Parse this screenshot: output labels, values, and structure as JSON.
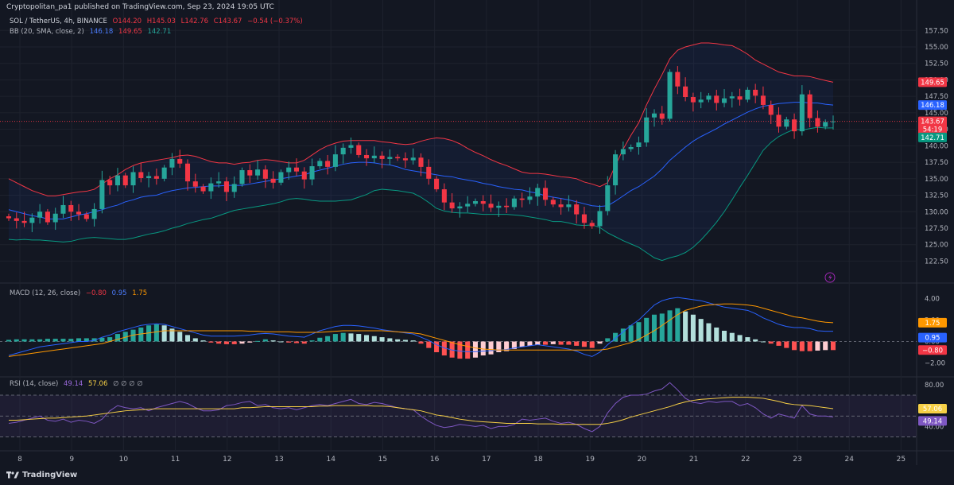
{
  "header": {
    "published": "Cryptopolitan_pa1 published on TradingView.com, Sep 23, 2024 19:05 UTC"
  },
  "symbol": {
    "name": "SOL / TetherUS, 4h, BINANCE",
    "o": "O144.20",
    "h": "H145.03",
    "l": "L142.76",
    "c": "C143.67",
    "chg": "−0.54 (−0.37%)"
  },
  "bb": {
    "label": "BB (20, SMA, close, 2)",
    "basis": "146.18",
    "upper": "149.65",
    "lower": "142.71"
  },
  "macd_legend": {
    "label": "MACD (12, 26, close)",
    "hist": "−0.80",
    "macd": "0.95",
    "signal": "1.75"
  },
  "rsi_legend": {
    "label": "RSI (14, close)",
    "rsi": "49.14",
    "ma": "57.06",
    "extra": "∅ ∅ ∅ ∅"
  },
  "footer": {
    "brand": "TradingView"
  },
  "colors": {
    "bg": "#131722",
    "up": "#26a69a",
    "down": "#f23645",
    "bb_basis": "#2962ff",
    "bb_upper": "#f23645",
    "bb_lower": "#089981",
    "macd": "#2962ff",
    "signal": "#ff9800",
    "rsi": "#7e57c2",
    "rsi_ma": "#f7d046"
  },
  "chart_data": [
    {
      "type": "candlestick",
      "title": "SOL / TetherUS, 4h, BINANCE",
      "x_ticks": [
        "8",
        "9",
        "10",
        "11",
        "12",
        "13",
        "14",
        "15",
        "16",
        "17",
        "18",
        "19",
        "20",
        "21",
        "22",
        "23",
        "24",
        "25"
      ],
      "y_ticks": [
        "122.50",
        "125.00",
        "127.50",
        "130.00",
        "132.50",
        "135.00",
        "137.50",
        "140.00",
        "142.50",
        "145.00",
        "147.50",
        "150.00",
        "152.50",
        "155.00",
        "157.50"
      ],
      "ylim": [
        120.5,
        158.5
      ],
      "price_labels": {
        "upper": "149.65",
        "basis": "146.18",
        "last": "143.67",
        "countdown": "54:19",
        "lower": "142.71"
      },
      "close": [
        129.0,
        128.6,
        128.3,
        129.1,
        130.0,
        128.4,
        129.7,
        131.0,
        130.0,
        129.6,
        128.9,
        130.4,
        134.8,
        134.0,
        135.5,
        134.0,
        136.0,
        135.1,
        135.4,
        135.0,
        136.7,
        138.0,
        137.3,
        134.6,
        133.8,
        133.1,
        134.3,
        134.6,
        133.0,
        134.2,
        136.3,
        135.5,
        136.4,
        135.0,
        134.4,
        136.0,
        136.7,
        136.1,
        134.9,
        136.9,
        137.7,
        136.8,
        138.7,
        139.7,
        140.1,
        138.6,
        138.1,
        138.5,
        138.0,
        138.3,
        138.1,
        137.8,
        138.2,
        136.8,
        135.0,
        133.4,
        131.4,
        130.5,
        130.8,
        131.2,
        131.6,
        131.2,
        130.6,
        130.9,
        130.7,
        132.0,
        131.8,
        132.3,
        133.6,
        131.8,
        131.1,
        130.7,
        131.1,
        129.6,
        128.3,
        127.8,
        130.1,
        134.0,
        138.7,
        139.5,
        139.8,
        140.5,
        144.3,
        144.9,
        144.1,
        151.2,
        149.0,
        147.4,
        146.6,
        147.0,
        147.6,
        146.5,
        147.2,
        147.5,
        147.0,
        148.5,
        147.6,
        146.2,
        144.7,
        142.9,
        144.0,
        142.2,
        147.8,
        144.2,
        142.9,
        143.6,
        143.7
      ],
      "bb_upper": [
        135.0,
        134.4,
        133.8,
        133.2,
        132.8,
        132.4,
        132.4,
        132.6,
        132.8,
        133.0,
        133.1,
        133.4,
        134.2,
        135.0,
        135.6,
        136.4,
        137.0,
        137.4,
        137.6,
        137.8,
        138.0,
        138.2,
        138.5,
        138.6,
        138.4,
        138.0,
        137.6,
        137.4,
        137.4,
        137.2,
        137.4,
        137.5,
        137.8,
        137.9,
        137.8,
        137.6,
        137.4,
        137.4,
        137.8,
        138.6,
        139.4,
        140.0,
        140.4,
        140.7,
        140.8,
        140.8,
        140.8,
        140.8,
        140.6,
        140.5,
        140.3,
        140.2,
        140.3,
        140.7,
        141.0,
        141.2,
        141.1,
        140.8,
        140.3,
        139.6,
        139.0,
        138.5,
        137.9,
        137.4,
        137.0,
        136.5,
        136.0,
        135.8,
        135.8,
        135.7,
        135.5,
        135.3,
        135.2,
        135.0,
        134.5,
        134.2,
        133.8,
        134.4,
        137.0,
        139.5,
        141.6,
        143.5,
        146.2,
        148.6,
        150.8,
        153.2,
        154.5,
        155.0,
        155.3,
        155.6,
        155.6,
        155.5,
        155.3,
        155.2,
        154.6,
        153.9,
        153.0,
        152.4,
        151.8,
        151.2,
        150.9,
        150.6,
        150.6,
        150.5,
        150.2,
        149.9,
        149.65
      ],
      "bb_basis": [
        130.3,
        130.0,
        129.7,
        129.4,
        129.2,
        128.9,
        128.9,
        128.9,
        129.2,
        129.5,
        129.7,
        130.0,
        130.3,
        130.7,
        131.0,
        131.5,
        131.8,
        132.2,
        132.4,
        132.5,
        132.9,
        133.2,
        133.4,
        133.6,
        133.7,
        133.8,
        133.9,
        133.9,
        134.0,
        134.0,
        134.0,
        134.2,
        134.4,
        134.6,
        134.8,
        135.0,
        135.2,
        135.4,
        135.6,
        136.0,
        136.3,
        136.6,
        136.9,
        137.2,
        137.4,
        137.5,
        137.5,
        137.4,
        137.2,
        137.1,
        136.8,
        136.4,
        136.2,
        136.0,
        135.8,
        135.6,
        135.4,
        135.3,
        135.0,
        134.8,
        134.6,
        134.3,
        134.1,
        133.8,
        133.6,
        133.4,
        133.3,
        133.0,
        132.8,
        132.4,
        132.2,
        132.0,
        131.8,
        131.5,
        131.2,
        130.9,
        130.8,
        130.9,
        131.6,
        132.4,
        133.2,
        133.8,
        134.6,
        135.4,
        136.5,
        137.8,
        138.8,
        139.8,
        140.7,
        141.4,
        142.0,
        142.6,
        143.3,
        143.9,
        144.5,
        145.1,
        145.6,
        146.0,
        146.2,
        146.4,
        146.5,
        146.6,
        146.6,
        146.5,
        146.5,
        146.3,
        146.18
      ],
      "bb_lower": [
        125.8,
        125.7,
        125.8,
        125.7,
        125.7,
        125.6,
        125.5,
        125.4,
        125.5,
        125.8,
        126.0,
        126.1,
        126.0,
        125.9,
        125.8,
        125.8,
        126.0,
        126.3,
        126.6,
        126.8,
        127.1,
        127.5,
        127.8,
        128.2,
        128.5,
        128.8,
        129.0,
        129.4,
        129.8,
        130.2,
        130.4,
        130.6,
        130.8,
        131.0,
        131.2,
        131.5,
        131.9,
        132.0,
        131.9,
        131.7,
        131.6,
        131.6,
        131.6,
        131.7,
        131.8,
        132.2,
        132.6,
        133.2,
        133.4,
        133.3,
        133.2,
        133.0,
        132.8,
        132.2,
        131.4,
        130.5,
        130.1,
        129.9,
        129.8,
        129.8,
        129.7,
        129.6,
        129.6,
        129.6,
        129.6,
        129.5,
        129.4,
        129.2,
        129.0,
        128.8,
        128.5,
        128.5,
        128.3,
        128.0,
        127.9,
        128.0,
        127.6,
        126.8,
        126.2,
        125.6,
        125.1,
        124.6,
        123.8,
        123.0,
        122.6,
        123.0,
        123.3,
        123.8,
        124.6,
        125.7,
        127.0,
        128.4,
        130.0,
        131.8,
        133.7,
        135.5,
        137.4,
        139.3,
        140.5,
        141.4,
        142.0,
        142.5,
        142.4,
        142.6,
        142.8,
        142.7,
        142.71
      ]
    },
    {
      "type": "bar",
      "title": "MACD (12, 26, close)",
      "y_ticks": [
        "4.00",
        "2.00",
        "0.00",
        "−2.00"
      ],
      "ylim": [
        -3.0,
        5.0
      ],
      "price_labels": {
        "signal": "1.75",
        "macd": "0.95",
        "hist": "−0.80"
      },
      "hist": [
        0.15,
        0.2,
        0.2,
        0.2,
        0.2,
        0.25,
        0.25,
        0.25,
        0.25,
        0.3,
        0.3,
        0.3,
        0.35,
        0.4,
        0.7,
        0.9,
        1.1,
        1.3,
        1.5,
        1.6,
        1.5,
        1.2,
        0.9,
        0.6,
        0.3,
        0.1,
        -0.1,
        -0.2,
        -0.25,
        -0.25,
        -0.2,
        -0.1,
        0.05,
        0.2,
        0.1,
        0.0,
        -0.1,
        -0.15,
        -0.2,
        0.1,
        0.35,
        0.5,
        0.7,
        0.8,
        0.75,
        0.7,
        0.6,
        0.5,
        0.4,
        0.3,
        0.2,
        0.15,
        0.1,
        -0.2,
        -0.6,
        -1.0,
        -1.3,
        -1.5,
        -1.6,
        -1.6,
        -1.5,
        -1.3,
        -1.2,
        -1.0,
        -0.9,
        -0.7,
        -0.5,
        -0.4,
        -0.3,
        -0.3,
        -0.25,
        -0.3,
        -0.3,
        -0.4,
        -0.5,
        -0.6,
        -0.2,
        0.3,
        0.8,
        1.2,
        1.5,
        1.8,
        2.2,
        2.5,
        2.6,
        2.9,
        3.1,
        2.8,
        2.5,
        2.1,
        1.7,
        1.3,
        1.0,
        0.8,
        0.6,
        0.4,
        0.2,
        0.0,
        -0.2,
        -0.4,
        -0.6,
        -0.8,
        -0.9,
        -0.9,
        -0.85,
        -0.8,
        -0.8
      ],
      "macd": [
        -1.3,
        -1.1,
        -0.9,
        -0.7,
        -0.5,
        -0.4,
        -0.3,
        -0.2,
        -0.1,
        0.0,
        0.0,
        0.1,
        0.4,
        0.6,
        0.9,
        1.1,
        1.3,
        1.5,
        1.6,
        1.65,
        1.6,
        1.4,
        1.2,
        1.0,
        0.8,
        0.6,
        0.5,
        0.5,
        0.5,
        0.5,
        0.55,
        0.6,
        0.7,
        0.75,
        0.7,
        0.6,
        0.5,
        0.45,
        0.4,
        0.7,
        1.0,
        1.2,
        1.4,
        1.5,
        1.5,
        1.45,
        1.35,
        1.25,
        1.1,
        1.0,
        0.9,
        0.8,
        0.7,
        0.4,
        0.1,
        -0.3,
        -0.6,
        -0.8,
        -0.9,
        -0.95,
        -0.95,
        -0.9,
        -0.85,
        -0.8,
        -0.75,
        -0.6,
        -0.5,
        -0.4,
        -0.3,
        -0.4,
        -0.5,
        -0.6,
        -0.7,
        -0.9,
        -1.2,
        -1.4,
        -1.0,
        -0.3,
        0.3,
        0.9,
        1.5,
        2.0,
        2.7,
        3.4,
        3.8,
        4.0,
        4.1,
        4.0,
        3.9,
        3.8,
        3.6,
        3.4,
        3.2,
        3.1,
        3.0,
        2.9,
        2.6,
        2.2,
        1.9,
        1.6,
        1.4,
        1.3,
        1.3,
        1.2,
        1.0,
        0.95,
        0.95
      ],
      "signal": [
        -1.4,
        -1.3,
        -1.2,
        -1.1,
        -1.0,
        -0.9,
        -0.8,
        -0.7,
        -0.6,
        -0.5,
        -0.4,
        -0.3,
        -0.2,
        0.0,
        0.2,
        0.4,
        0.6,
        0.7,
        0.8,
        0.9,
        1.0,
        1.0,
        1.0,
        1.0,
        1.0,
        1.0,
        1.0,
        1.0,
        1.0,
        1.0,
        1.0,
        0.95,
        0.95,
        0.9,
        0.9,
        0.9,
        0.9,
        0.85,
        0.85,
        0.85,
        0.85,
        0.9,
        0.95,
        1.0,
        1.0,
        1.0,
        1.0,
        1.0,
        1.0,
        0.95,
        0.9,
        0.85,
        0.8,
        0.7,
        0.5,
        0.3,
        0.1,
        -0.1,
        -0.3,
        -0.45,
        -0.6,
        -0.7,
        -0.75,
        -0.8,
        -0.8,
        -0.8,
        -0.8,
        -0.8,
        -0.8,
        -0.8,
        -0.8,
        -0.8,
        -0.8,
        -0.8,
        -0.8,
        -0.8,
        -0.8,
        -0.7,
        -0.5,
        -0.3,
        -0.1,
        0.2,
        0.6,
        1.0,
        1.5,
        2.0,
        2.5,
        2.9,
        3.1,
        3.3,
        3.4,
        3.45,
        3.5,
        3.5,
        3.45,
        3.4,
        3.3,
        3.1,
        2.9,
        2.7,
        2.5,
        2.3,
        2.2,
        2.05,
        1.9,
        1.8,
        1.75
      ]
    },
    {
      "type": "line",
      "title": "RSI (14, close)",
      "y_ticks": [
        "80.00",
        "40.00"
      ],
      "ylim": [
        22,
        86
      ],
      "bands": [
        30,
        70
      ],
      "price_labels": {
        "ma": "57.06",
        "rsi": "49.14"
      },
      "rsi": [
        43,
        44,
        46,
        48,
        50,
        46,
        45,
        47,
        44,
        46,
        45,
        43,
        47,
        55,
        60,
        58,
        57,
        58,
        55,
        58,
        60,
        62,
        64,
        62,
        58,
        55,
        55,
        56,
        60,
        61,
        63,
        64,
        60,
        61,
        58,
        57,
        58,
        56,
        58,
        60,
        61,
        60,
        62,
        64,
        66,
        62,
        61,
        63,
        62,
        60,
        58,
        57,
        56,
        50,
        45,
        41,
        39,
        40,
        42,
        41,
        40,
        41,
        38,
        40,
        40,
        42,
        47,
        46,
        47,
        48,
        45,
        43,
        44,
        42,
        38,
        35,
        40,
        53,
        62,
        68,
        70,
        70,
        71,
        74,
        76,
        82,
        75,
        67,
        63,
        62,
        64,
        63,
        64,
        64,
        60,
        62,
        58,
        52,
        48,
        52,
        50,
        48,
        60,
        52,
        50,
        50,
        49.14
      ],
      "rsi_ma": [
        46,
        46,
        46.5,
        47,
        47.5,
        48,
        48,
        48.5,
        49,
        49.5,
        50,
        51,
        52,
        53,
        54,
        55,
        55.5,
        56,
        56.5,
        57,
        57,
        57,
        57,
        57,
        57,
        57,
        57,
        57,
        57,
        57,
        58,
        58,
        58.5,
        59,
        59,
        59,
        59,
        59,
        59,
        59,
        59.5,
        59.5,
        60,
        60,
        60,
        60,
        60,
        59.5,
        59.5,
        59,
        58,
        57,
        56,
        55,
        53,
        51,
        50,
        48.5,
        47,
        46,
        45,
        44.5,
        44,
        43.5,
        43,
        43,
        43,
        43,
        42.5,
        42.5,
        42.5,
        42,
        42,
        42,
        42,
        42,
        42,
        43,
        44.5,
        46.5,
        49,
        51,
        53,
        55,
        57,
        59,
        61.5,
        63.5,
        65,
        66,
        66.5,
        67,
        67.5,
        68,
        68,
        68,
        67.5,
        67,
        65.5,
        64,
        62,
        61,
        60.5,
        60,
        59,
        58,
        57.06
      ]
    }
  ]
}
